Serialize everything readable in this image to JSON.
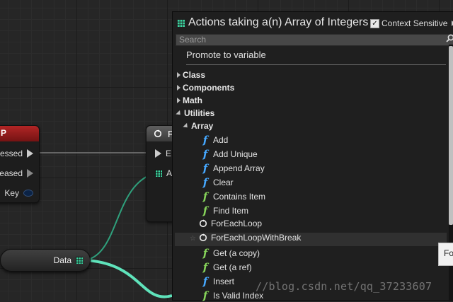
{
  "left_node": {
    "pins": [
      {
        "label": "essed"
      },
      {
        "label": "eased"
      },
      {
        "label": "Key"
      }
    ]
  },
  "foreach_node": {
    "header_letter": "F",
    "pins": [
      {
        "label": "E"
      },
      {
        "label": "A"
      }
    ]
  },
  "data_node": {
    "label": "Data"
  },
  "actions_panel": {
    "title": "Actions taking a(n) Array of Integers",
    "context_sensitive_label": "Context Sensitive",
    "context_sensitive_checked": true,
    "search_placeholder": "Search",
    "promote_label": "Promote to variable",
    "categories": [
      {
        "label": "Class",
        "expanded": false
      },
      {
        "label": "Components",
        "expanded": false
      },
      {
        "label": "Math",
        "expanded": false
      },
      {
        "label": "Utilities",
        "expanded": true
      }
    ],
    "subcategory": {
      "label": "Array",
      "expanded": true
    },
    "array_items": [
      {
        "label": "Add",
        "icon": "function-icon",
        "color": "#46a8ff"
      },
      {
        "label": "Add Unique",
        "icon": "function-icon",
        "color": "#46a8ff"
      },
      {
        "label": "Append Array",
        "icon": "function-icon",
        "color": "#46a8ff"
      },
      {
        "label": "Clear",
        "icon": "function-icon",
        "color": "#46a8ff"
      },
      {
        "label": "Contains Item",
        "icon": "function-icon",
        "color": "#86d35a"
      },
      {
        "label": "Find Item",
        "icon": "function-icon",
        "color": "#86d35a"
      },
      {
        "label": "ForEachLoop",
        "icon": "macro-loop-icon"
      },
      {
        "label": "ForEachLoopWithBreak",
        "icon": "macro-loop-icon",
        "selected": true
      },
      {
        "label": "Get (a copy)",
        "icon": "function-icon",
        "color": "#86d35a"
      },
      {
        "label": "Get (a ref)",
        "icon": "function-icon",
        "color": "#86d35a"
      },
      {
        "label": "Insert",
        "icon": "function-icon",
        "color": "#46a8ff"
      },
      {
        "label": "Is Valid Index",
        "icon": "function-icon",
        "color": "#86d35a"
      }
    ]
  },
  "tooltip": {
    "text": "Fo"
  },
  "watermark": "//blog.csdn.net/qq_37233607",
  "colors": {
    "event_header": "#b22525",
    "array_pin": "#3bd4a0",
    "pure_function": "#86d35a",
    "impure_function": "#46a8ff"
  }
}
